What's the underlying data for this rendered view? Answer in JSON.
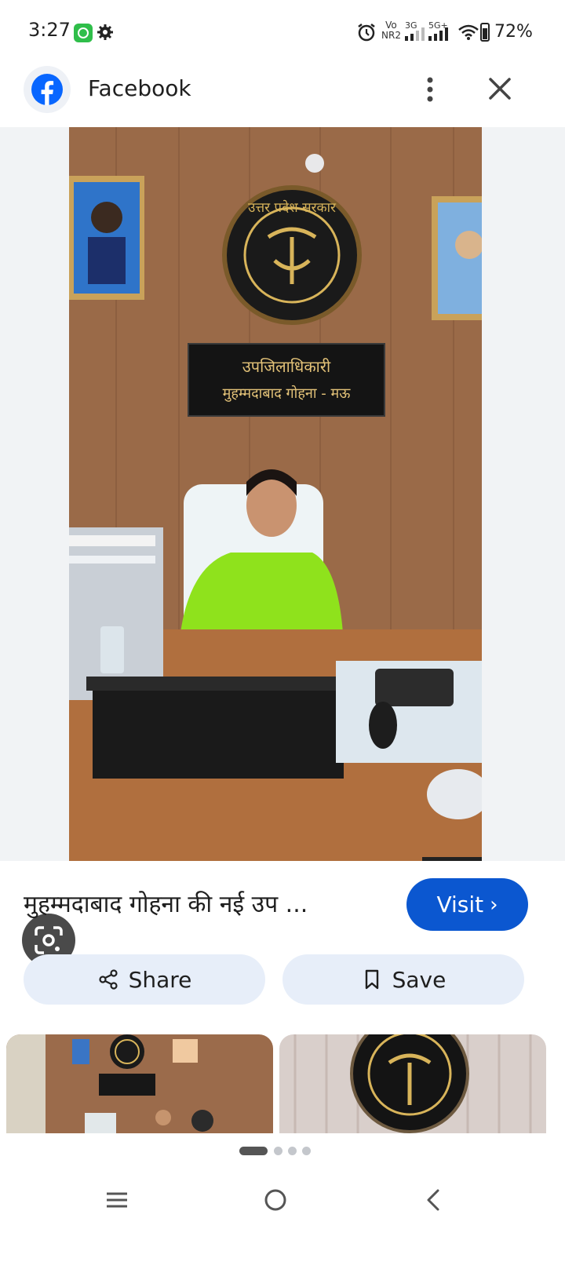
{
  "status_bar": {
    "time": "3:27",
    "network_vo": "Vo",
    "network_nr": "NR2",
    "network_3g": "3G",
    "network_5g": "5G+",
    "battery": "72%",
    "icons": [
      "whatsapp-icon",
      "gear-icon",
      "alarm-icon",
      "signal-icon",
      "wifi-icon",
      "battery-icon"
    ]
  },
  "header": {
    "title": "Facebook",
    "icons": [
      "facebook-logo",
      "more-icon",
      "close-icon"
    ]
  },
  "image": {
    "sign_line1": "उपजिलाधिकारी",
    "sign_line2": "मुहम्मदाबाद गोहना - मऊ",
    "emblem_text": "उत्तर प्रदेश सरकार"
  },
  "result": {
    "caption": "मुहम्मदाबाद गोहना की नई उप ...",
    "visit_label": "Visit",
    "visit_chevron": "›"
  },
  "actions": {
    "share_label": "Share",
    "save_label": "Save"
  },
  "colors": {
    "accent": "#0b57d0",
    "chip_bg": "#e7eef9",
    "facebook_blue": "#0866ff"
  }
}
